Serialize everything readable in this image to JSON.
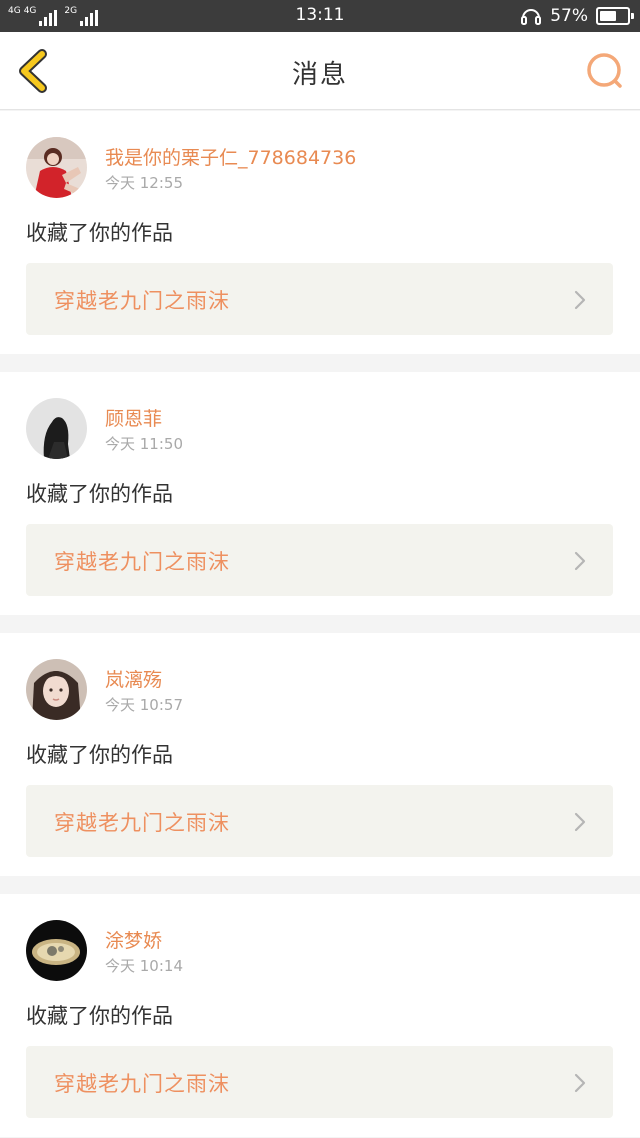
{
  "status_bar": {
    "network_1": "4G",
    "network_2": "4G",
    "network_3": "2G",
    "time": "13:11",
    "battery": "57%",
    "battery_level": 0.57
  },
  "header": {
    "title": "消息",
    "back_icon": "chevron-left-icon",
    "search_icon": "search-icon"
  },
  "colors": {
    "accent": "#e88a52",
    "back_yellow": "#f6c81e",
    "work_bg": "#f3f3ee"
  },
  "messages": [
    {
      "username": "我是你的栗子仁_778684736",
      "time": "今天 12:55",
      "action": "收藏了你的作品",
      "work_title": "穿越老九门之雨沫"
    },
    {
      "username": "顾恩菲",
      "time": "今天 11:50",
      "action": "收藏了你的作品",
      "work_title": "穿越老九门之雨沫"
    },
    {
      "username": "岚漓殇",
      "time": "今天 10:57",
      "action": "收藏了你的作品",
      "work_title": "穿越老九门之雨沫"
    },
    {
      "username": "涂梦娇",
      "time": "今天 10:14",
      "action": "收藏了你的作品",
      "work_title": "穿越老九门之雨沫"
    }
  ]
}
